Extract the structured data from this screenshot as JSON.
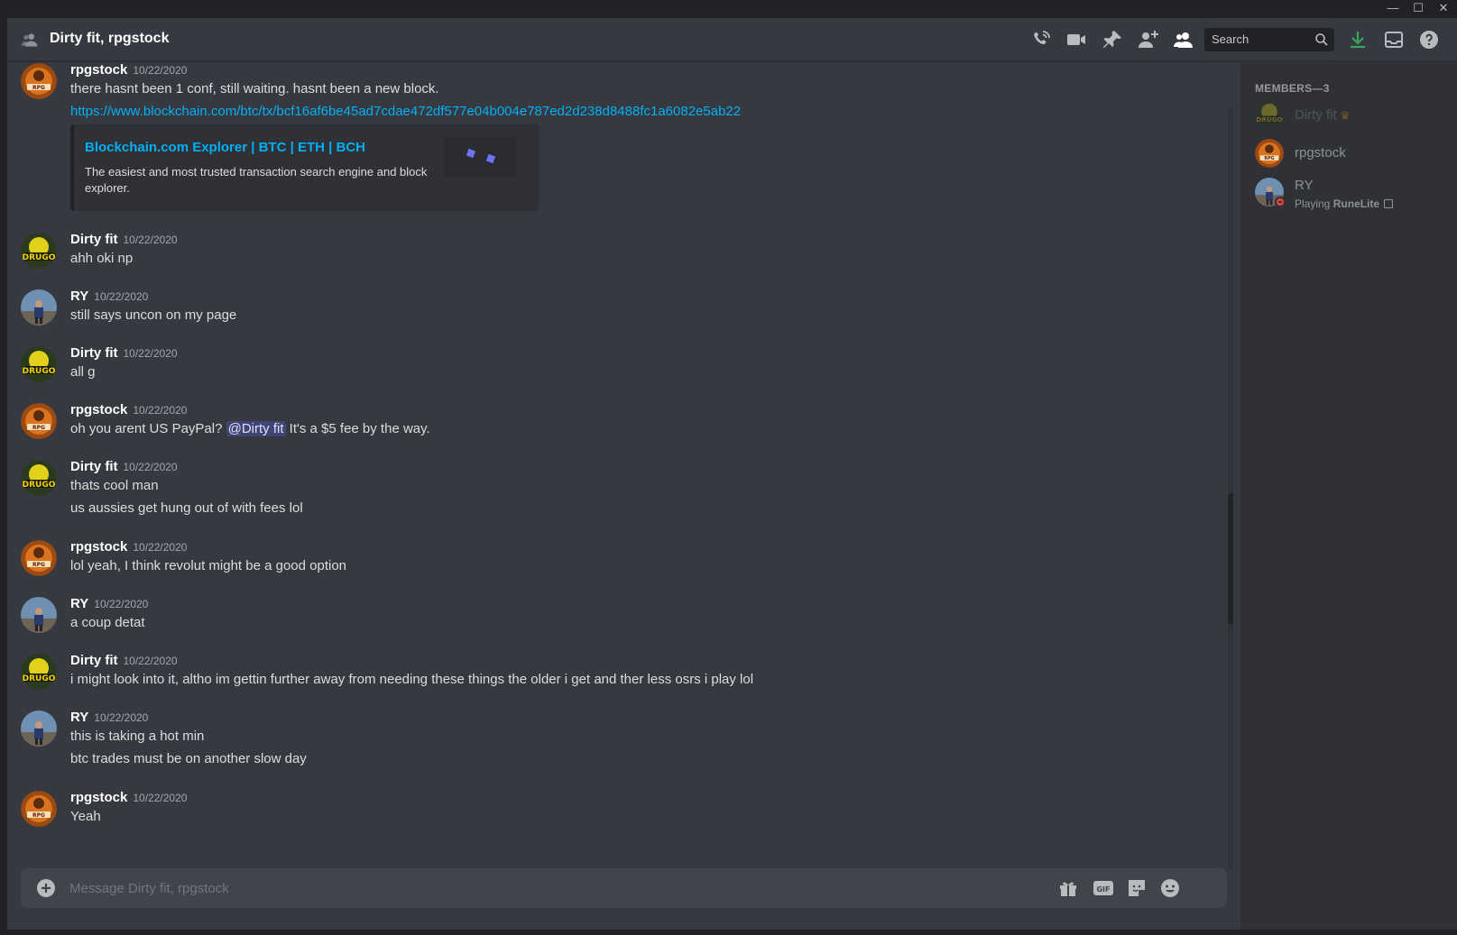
{
  "window": {
    "minimize_glyph": "—",
    "maximize_glyph": "☐",
    "close_glyph": "✕"
  },
  "header": {
    "title": "Dirty fit, rpgstock",
    "search_placeholder": "Search",
    "icons": [
      "dm-group-icon",
      "start-voice-call-icon",
      "start-video-call-icon",
      "pinned-messages-icon",
      "add-friends-to-dm-icon",
      "member-list-icon",
      "search-icon",
      "download-icon",
      "inbox-icon",
      "help-icon"
    ]
  },
  "colors": {
    "background": "#36393f",
    "sidebar": "#2f3136",
    "link": "#00b0f4",
    "download_green": "#3ba55d",
    "dnd_red": "#ed4245",
    "crown": "#faa81a"
  },
  "messages": [
    {
      "author": "rpgstock",
      "timestamp": "10/22/2020",
      "lines": [
        "there hasnt been 1 conf, still waiting. hasnt been a new block."
      ],
      "link": "https://www.blockchain.com/btc/tx/bcf16af6be45ad7cdae472df577e04b004e787ed2d238d8488fc1a6082e5ab22",
      "embed": {
        "title": "Blockchain.com Explorer | BTC | ETH | BCH",
        "description": "The easiest and most trusted transaction search engine and block explorer."
      }
    },
    {
      "author": "Dirty fit",
      "timestamp": "10/22/2020",
      "lines": [
        "ahh oki np"
      ]
    },
    {
      "author": "RY",
      "timestamp": "10/22/2020",
      "lines": [
        "still says uncon on my page"
      ]
    },
    {
      "author": "Dirty fit",
      "timestamp": "10/22/2020",
      "lines": [
        "all g"
      ]
    },
    {
      "author": "rpgstock",
      "timestamp": "10/22/2020",
      "line_prefix": "oh you arent US PayPal?",
      "mention": "@Dirty fit",
      "line_suffix": "It's a $5 fee by the way."
    },
    {
      "author": "Dirty fit",
      "timestamp": "10/22/2020",
      "lines": [
        "thats cool man",
        "us aussies get hung out of with fees lol"
      ]
    },
    {
      "author": "rpgstock",
      "timestamp": "10/22/2020",
      "lines": [
        "lol yeah, I think revolut might be a good option"
      ]
    },
    {
      "author": "RY",
      "timestamp": "10/22/2020",
      "lines": [
        "a coup detat"
      ]
    },
    {
      "author": "Dirty fit",
      "timestamp": "10/22/2020",
      "lines": [
        "i might look into it, altho im gettin further away from needing these things the older i get and ther less osrs i play lol"
      ]
    },
    {
      "author": "RY",
      "timestamp": "10/22/2020",
      "lines": [
        "this is taking a hot min",
        "btc trades must be on another slow day"
      ]
    },
    {
      "author": "rpgstock",
      "timestamp": "10/22/2020",
      "lines": [
        "Yeah"
      ]
    }
  ],
  "composer": {
    "placeholder": "Message Dirty fit, rpgstock",
    "buttons": [
      "gift-icon",
      "gif-icon",
      "sticker-icon",
      "emoji-icon"
    ],
    "gif_label": "GIF"
  },
  "members": {
    "header": "MEMBERS—3",
    "list": [
      {
        "name": "Dirty fit",
        "owner": true,
        "crown_glyph": "♛"
      },
      {
        "name": "rpgstock"
      },
      {
        "name": "RY",
        "status_prefix": "Playing",
        "status_game": "RuneLite",
        "presence": "do-not-disturb"
      }
    ]
  }
}
